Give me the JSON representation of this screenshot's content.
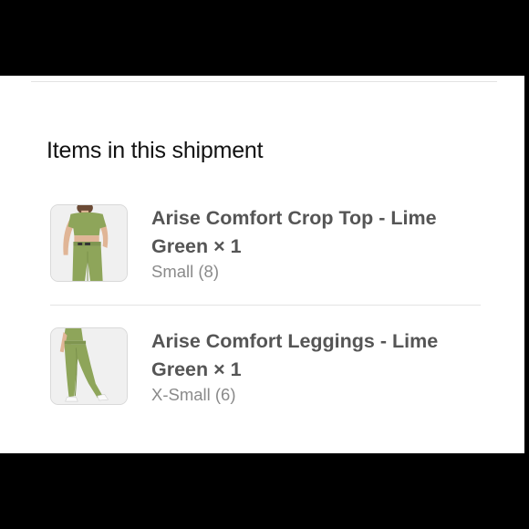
{
  "shipment": {
    "section_title": "Items in this shipment",
    "items": [
      {
        "name": "Arise Comfort Crop Top - Lime Green × 1",
        "variant": "Small (8)",
        "thumbnail_icon": "crop-top-product-photo"
      },
      {
        "name": "Arise Comfort Leggings - Lime Green × 1",
        "variant": "X-Small (6)",
        "thumbnail_icon": "leggings-product-photo"
      }
    ]
  },
  "colors": {
    "product_green": "#8ea55a",
    "text_primary": "#555555",
    "text_secondary": "#8a8a8a",
    "divider": "#e3e3e3"
  }
}
